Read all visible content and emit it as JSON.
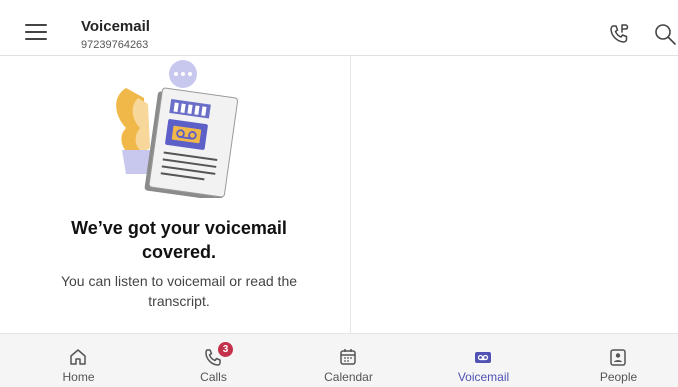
{
  "header": {
    "title": "Voicemail",
    "subtitle": "97239764263",
    "icons": {
      "menu": "hamburger-icon",
      "dialpad": "phone-dialpad-icon",
      "search": "search-icon"
    }
  },
  "empty_state": {
    "headline": "We’ve got your voicemail covered.",
    "description": "You can listen to voicemail or read the transcript."
  },
  "bottom_nav": {
    "items": [
      {
        "label": "Home",
        "icon": "home-icon"
      },
      {
        "label": "Calls",
        "icon": "calls-icon",
        "badge": "3"
      },
      {
        "label": "Calendar",
        "icon": "calendar-icon"
      },
      {
        "label": "Voicemail",
        "icon": "voicemail-icon",
        "active": true
      },
      {
        "label": "People",
        "icon": "people-icon"
      }
    ]
  },
  "colors": {
    "accent": "#4f52b2",
    "badge": "#c4314b"
  }
}
